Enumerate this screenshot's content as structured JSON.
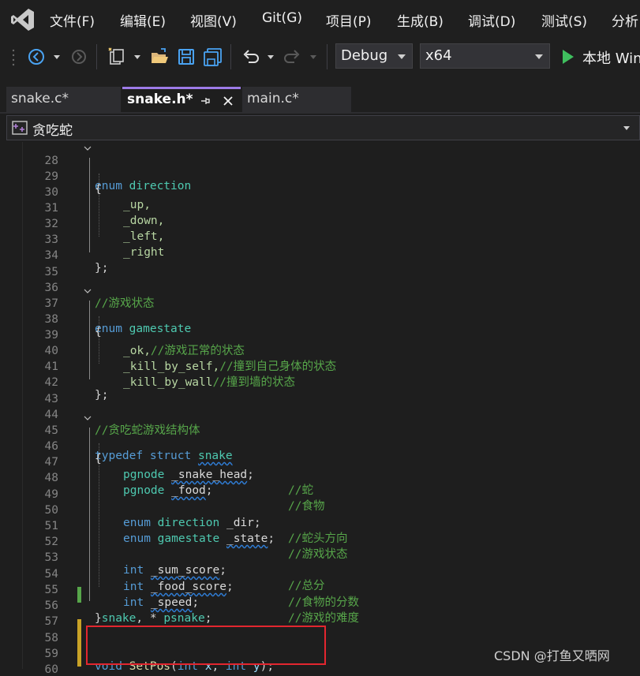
{
  "menu": [
    "文件(F)",
    "编辑(E)",
    "视图(V)",
    "Git(G)",
    "项目(P)",
    "生成(B)",
    "调试(D)",
    "测试(S)",
    "分析"
  ],
  "toolbar": {
    "config": "Debug",
    "platform": "x64",
    "run_label": "本地 Win"
  },
  "tabs": [
    {
      "label": "snake.c*",
      "active": false
    },
    {
      "label": "snake.h*",
      "active": true
    },
    {
      "label": "main.c*",
      "active": false
    }
  ],
  "navbar": {
    "scope": "贪吃蛇"
  },
  "editor": {
    "line_numbers": [
      "28",
      "29",
      "30",
      "31",
      "32",
      "33",
      "34",
      "35",
      "36",
      "37",
      "38",
      "39",
      "40",
      "41",
      "42",
      "43",
      "44",
      "45",
      "46",
      "47",
      "48",
      "49",
      "50",
      "51",
      "52",
      "53",
      "54",
      "55",
      "56",
      "57",
      "58",
      "59",
      "60"
    ],
    "code": {
      "l28": [
        "enum",
        "direction"
      ],
      "l29": "{",
      "l30": "_up,",
      "l31": "_down,",
      "l32": "_left,",
      "l33": "_right",
      "l34": "};",
      "l36": "//游戏状态",
      "l37": [
        "enum",
        "gamestate"
      ],
      "l38": "{",
      "l39": [
        "_ok,",
        "//游戏正常的状态"
      ],
      "l40": [
        "_kill_by_self,",
        "//撞到自己身体的状态"
      ],
      "l41": [
        "_kill_by_wall",
        "//撞到墙的状态"
      ],
      "l42": "};",
      "l44": "//贪吃蛇游戏结构体",
      "l45": [
        "typedef",
        "struct",
        "snake"
      ],
      "l46": "{",
      "l47": [
        "pgnode",
        "_snake_head",
        ";",
        "//蛇"
      ],
      "l48": [
        "pgnode",
        "_food",
        ";",
        "//食物"
      ],
      "l50": [
        "enum",
        "direction",
        "_dir",
        ";",
        "//蛇头方向"
      ],
      "l51": [
        "enum",
        "gamestate",
        "_state",
        ";",
        "//游戏状态"
      ],
      "l53": [
        "int",
        "_sum_score",
        ";",
        "//总分"
      ],
      "l54": [
        "int",
        "_food_score",
        ";",
        "//食物的分数"
      ],
      "l55": [
        "int",
        "_speed",
        ";",
        "//游戏的难度"
      ],
      "l56": [
        "}",
        "snake",
        ", *",
        "psnake",
        ";"
      ],
      "l59": [
        "void",
        "SetPos",
        "(",
        "int",
        "x",
        ",",
        "int",
        "y",
        ");"
      ]
    }
  },
  "watermark": "CSDN @打鱼又晒网",
  "colors": {
    "keyword": "#569cd6",
    "type": "#4ec9b0",
    "enum_member": "#b8d7a3",
    "comment": "#57a64a",
    "function": "#dcdcaa",
    "parameter": "#9cdcfe",
    "highlight_box": "#e3262f",
    "active_tab_accent": "#9d7be8",
    "change_marker": "#57a64a"
  }
}
